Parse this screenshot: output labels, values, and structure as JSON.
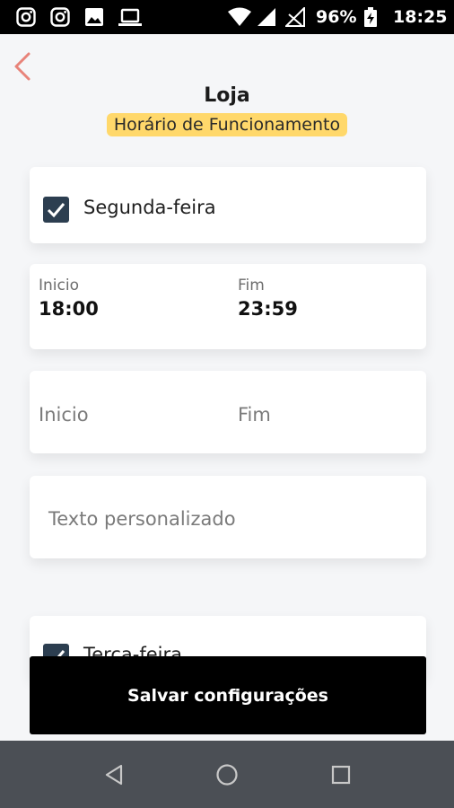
{
  "status_bar": {
    "battery": "96%",
    "time": "18:25",
    "icons": [
      "instagram-icon",
      "instagram-icon",
      "image-icon",
      "laptop-icon",
      "wifi-icon",
      "signal-icon",
      "signal-off-icon",
      "battery-charging-icon"
    ]
  },
  "header": {
    "title": "Loja",
    "subtitle": "Horário de Funcionamento"
  },
  "schedule": {
    "day1": {
      "label": "Segunda-feira",
      "checked": true,
      "slot1": {
        "start_label": "Inicio",
        "start_value": "18:00",
        "end_label": "Fim",
        "end_value": "23:59"
      },
      "slot2": {
        "start_placeholder": "Inicio",
        "end_placeholder": "Fim"
      },
      "custom_text_placeholder": "Texto personalizado"
    },
    "day2": {
      "label": "Terça-feira",
      "checked": true
    }
  },
  "save_button": {
    "label": "Salvar configurações"
  },
  "colors": {
    "accent_back": "#e8837a",
    "highlight": "#ffd86b",
    "checkbox": "#2c3e50",
    "button_bg": "#000000",
    "navbar_bg": "#4b4f55"
  }
}
